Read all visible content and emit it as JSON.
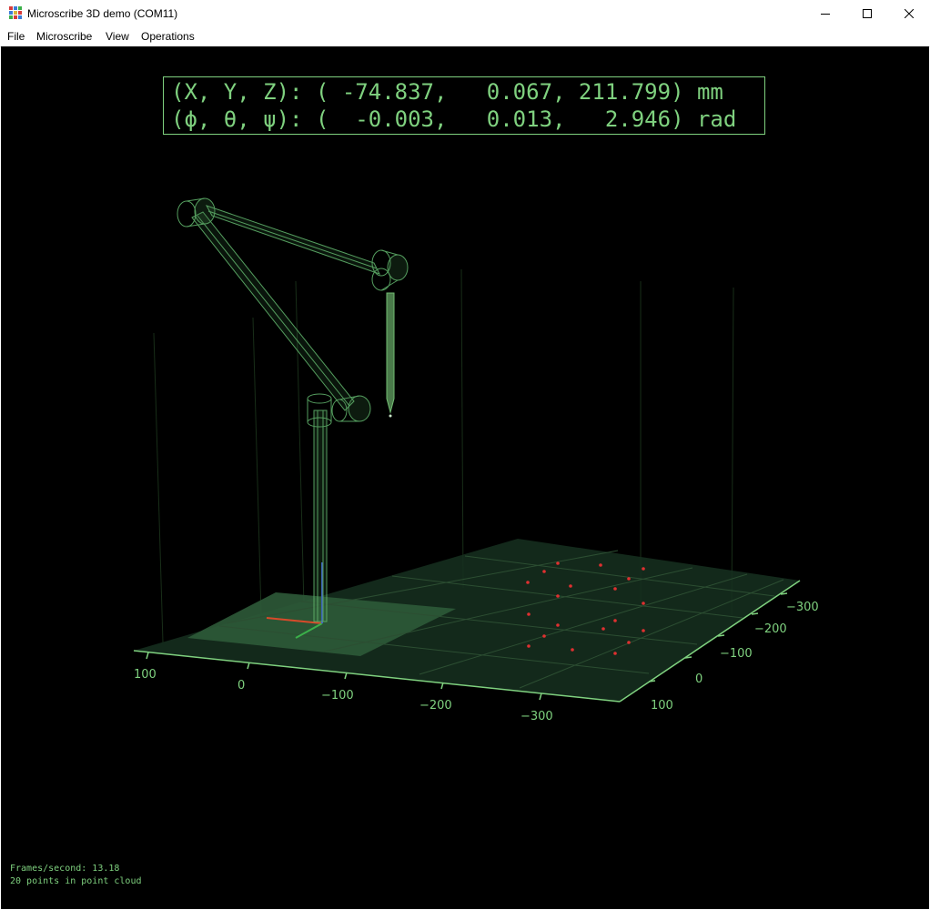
{
  "window": {
    "title": "Microscribe 3D demo (COM11)",
    "minimize_label": "Minimize",
    "maximize_label": "Maximize",
    "close_label": "Close"
  },
  "menu": {
    "items": [
      "File",
      "Microscribe",
      "View",
      "Operations"
    ]
  },
  "readout": {
    "position_line": "(X, Y, Z): ( -74.837,   0.067, 211.799) mm",
    "orientation_line": "(ϕ, θ, ψ): (  -0.003,   0.013,   2.946) rad"
  },
  "axes": {
    "x_ticks": [
      "100",
      "0",
      "−100",
      "−200",
      "−300"
    ],
    "y_ticks": [
      "−300",
      "−200",
      "−100",
      "0",
      "100"
    ]
  },
  "status": {
    "fps": "Frames/second: 13.18",
    "points": "20 points in point cloud"
  },
  "colors": {
    "accent": "#7fd17f",
    "background": "#000000",
    "point": "#e03030"
  }
}
